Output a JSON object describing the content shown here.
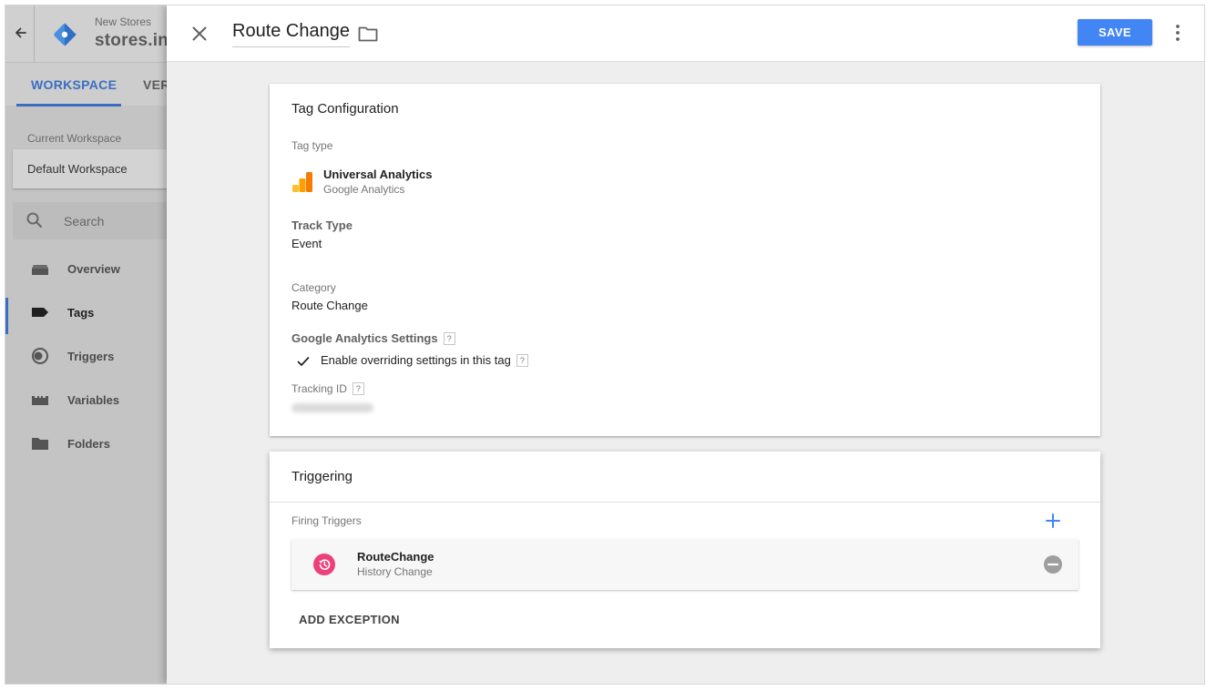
{
  "sidebar": {
    "account_name": "New Stores",
    "container_name": "stores.in",
    "tabs": [
      {
        "label": "WORKSPACE",
        "active": true
      },
      {
        "label": "VER",
        "active": false
      }
    ],
    "current_workspace_label": "Current Workspace",
    "current_workspace_value": "Default Workspace",
    "search_placeholder": "Search",
    "nav": [
      {
        "label": "Overview",
        "icon": "overview-icon",
        "active": false
      },
      {
        "label": "Tags",
        "icon": "tag-icon",
        "active": true
      },
      {
        "label": "Triggers",
        "icon": "trigger-icon",
        "active": false
      },
      {
        "label": "Variables",
        "icon": "variables-icon",
        "active": false
      },
      {
        "label": "Folders",
        "icon": "folder-icon",
        "active": false
      }
    ]
  },
  "editor": {
    "title": "Route Change",
    "save_label": "SAVE",
    "config": {
      "title": "Tag Configuration",
      "tag_type_label": "Tag type",
      "tag_type_name": "Universal Analytics",
      "tag_type_vendor": "Google Analytics",
      "track_type_label": "Track Type",
      "track_type_value": "Event",
      "category_label": "Category",
      "category_value": "Route Change",
      "ga_settings_label": "Google Analytics Settings",
      "override_label": "Enable overriding settings in this tag",
      "override_checked": true,
      "tracking_id_label": "Tracking ID",
      "help_glyph": "?"
    },
    "triggering": {
      "title": "Triggering",
      "firing_label": "Firing Triggers",
      "triggers": [
        {
          "name": "RouteChange",
          "type": "History Change",
          "icon": "history-icon",
          "color": "#ec407a"
        }
      ],
      "add_exception_label": "ADD EXCEPTION"
    }
  },
  "colors": {
    "accent": "#4285f4",
    "nav_active": "#3a6fbf",
    "trigger_history": "#ec407a",
    "ga_orange": "#f57c00",
    "ga_yellow": "#fbc02d"
  }
}
